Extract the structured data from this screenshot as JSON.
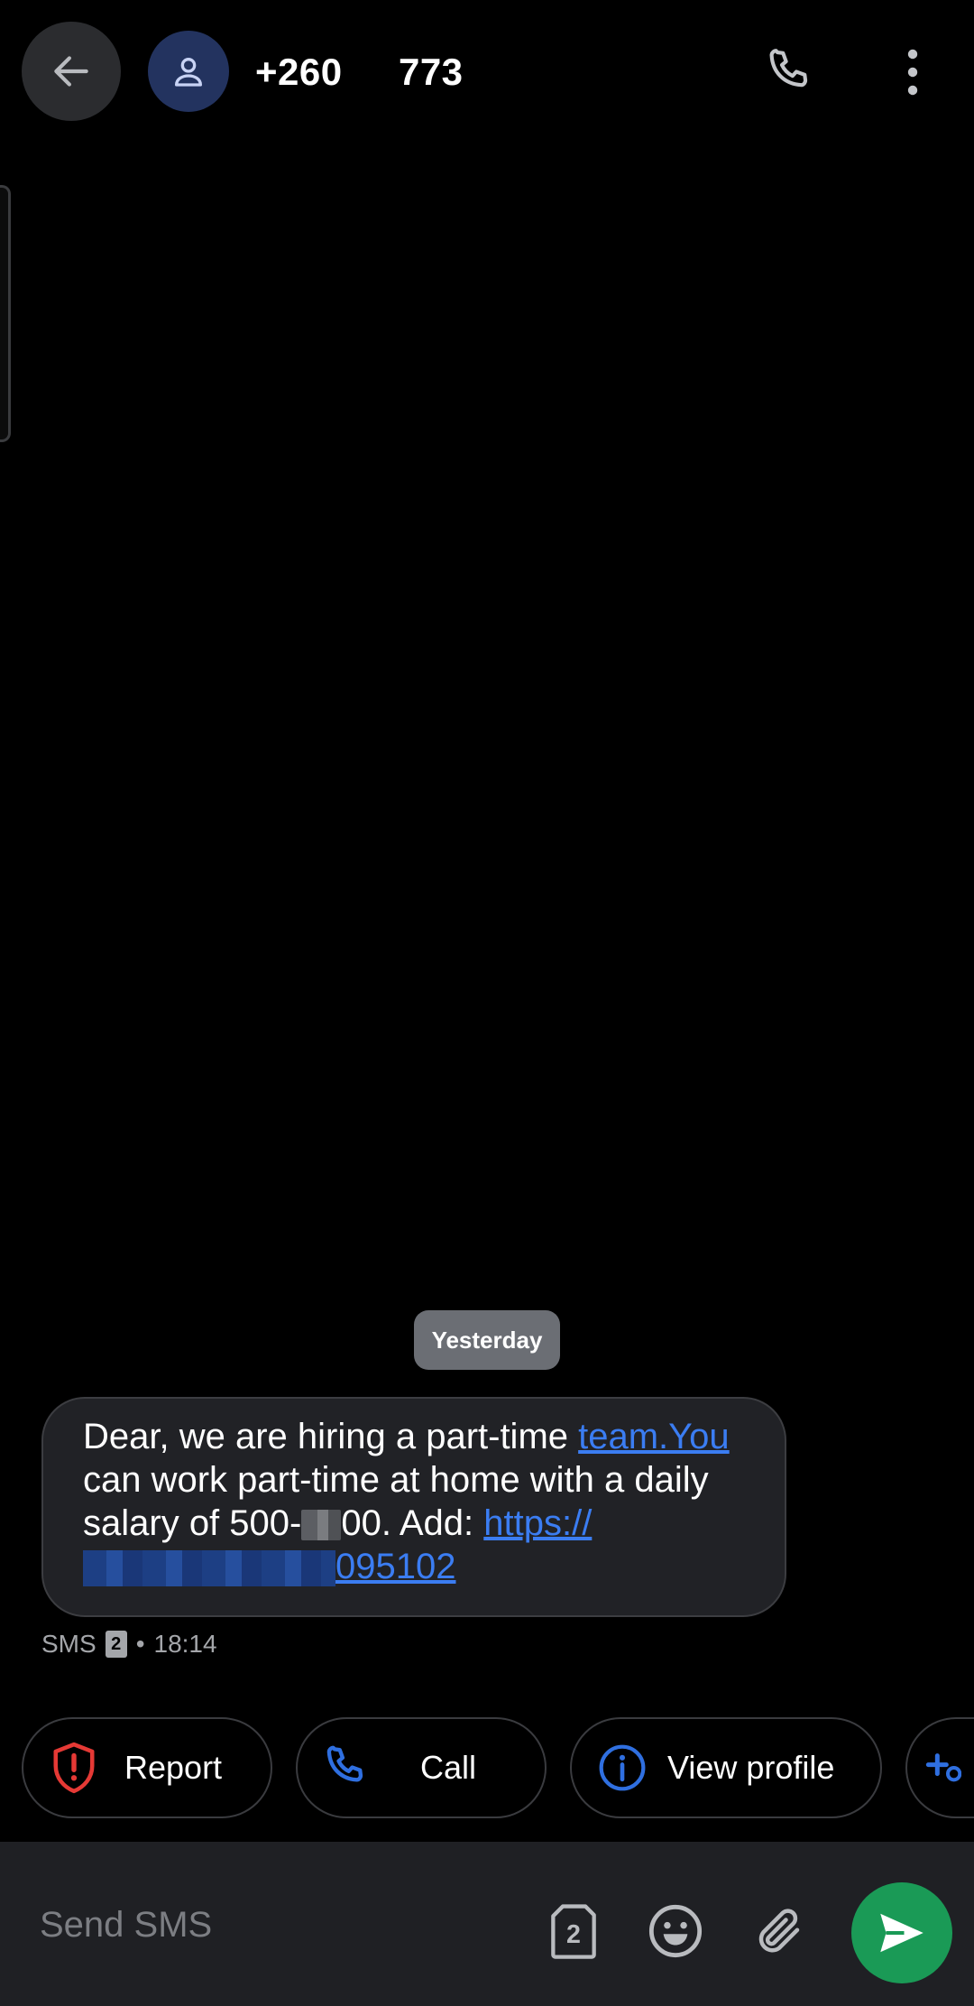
{
  "header": {
    "contact_name": "+260       773",
    "icons": [
      "back-arrow-icon",
      "contact-avatar-icon",
      "phone-call-icon",
      "more-vertical-icon"
    ]
  },
  "conversation": {
    "date_chip": "Yesterday",
    "message": {
      "text_1": "Dear, we are hiring a part-time ",
      "link_1": "team.You",
      "text_2": " can work part-time at home with a daily salary of 500-",
      "text_3": "00. Add: ",
      "link_2_prefix": "https://",
      "link_2_suffix": "095102",
      "channel": "SMS",
      "sim": "2",
      "separator": "•",
      "time": "18:14"
    }
  },
  "suggestions": [
    {
      "label": "Report",
      "icon": "shield-alert-icon",
      "color": "#e53935"
    },
    {
      "label": "Call",
      "icon": "phone-icon",
      "color": "#2f6fe0"
    },
    {
      "label": "View profile",
      "icon": "info-icon",
      "color": "#2f6fe0"
    }
  ],
  "composer": {
    "placeholder": "Send SMS",
    "value": "",
    "sim_label": "2",
    "icons": [
      "sim-2-icon",
      "emoji-icon",
      "attach-icon",
      "send-icon"
    ],
    "send_color": "#1a9a56"
  },
  "colors": {
    "background": "#000000",
    "bubble": "#212226",
    "link": "#3b7df2"
  }
}
